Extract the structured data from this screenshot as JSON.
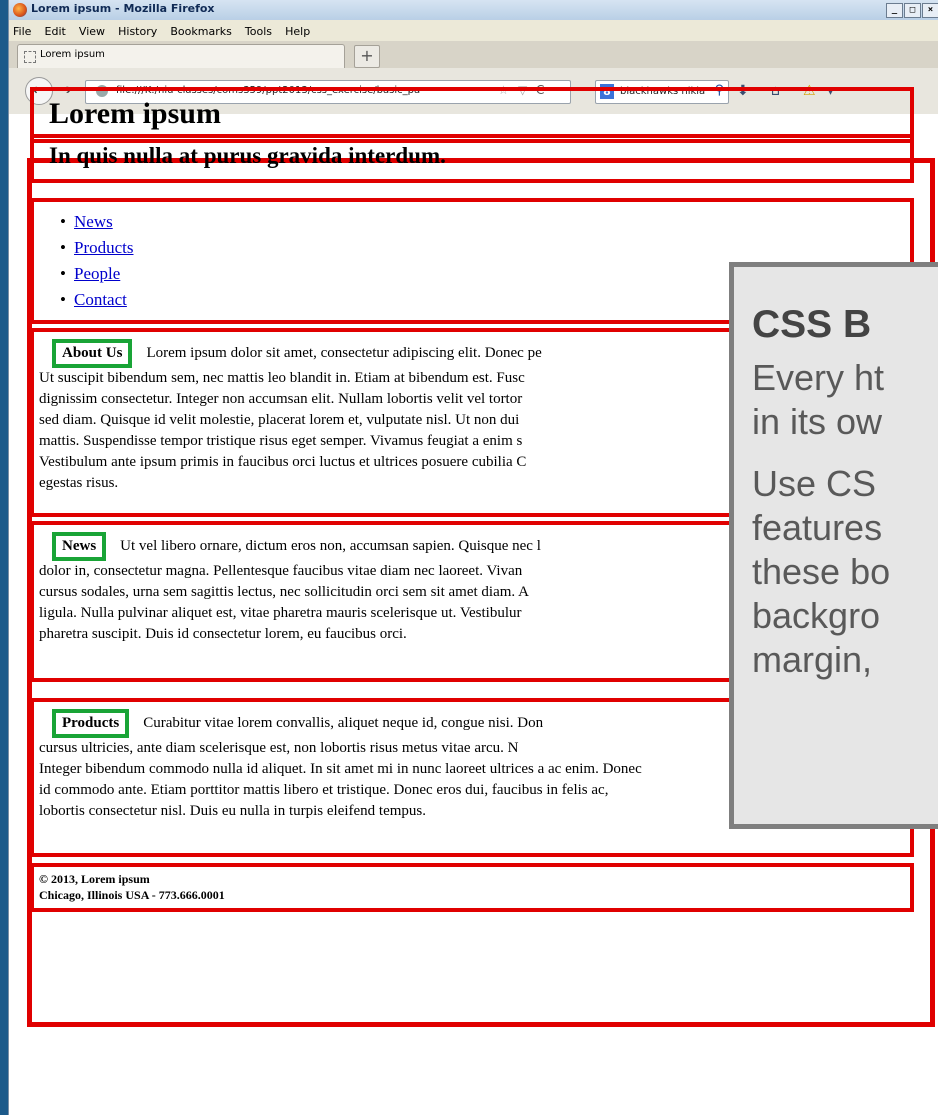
{
  "window": {
    "title": "Lorem ipsum - Mozilla Firefox",
    "buttons": [
      "_",
      "□",
      "×"
    ]
  },
  "menu": [
    "File",
    "Edit",
    "View",
    "History",
    "Bookmarks",
    "Tools",
    "Help"
  ],
  "tab": {
    "label": "Lorem ipsum",
    "new_tab": "+"
  },
  "navbar": {
    "url": "file:///K:/niu-classes/coms359/ppt2013/css_exercise/basic_pa",
    "search_engine": "8",
    "search_text": "blackhawks nikla"
  },
  "page": {
    "h1": "Lorem ipsum",
    "h2": "In quis nulla at purus gravida interdum.",
    "nav_links": [
      "News",
      "Products",
      "People",
      "Contact"
    ],
    "about": {
      "label": "About Us",
      "lines": [
        "Lorem ipsum dolor sit amet, consectetur adipiscing elit. Donec pe",
        "Ut suscipit bibendum sem, nec mattis leo blandit in. Etiam at bibendum est. Fusc",
        "dignissim consectetur. Integer non accumsan elit. Nullam lobortis velit vel tortor",
        "sed diam. Quisque id velit molestie, placerat lorem et, vulputate nisl. Ut non dui",
        "mattis. Suspendisse tempor tristique risus eget semper. Vivamus feugiat a enim s",
        "Vestibulum ante ipsum primis in faucibus orci luctus et ultrices posuere cubilia C",
        "egestas risus."
      ]
    },
    "news": {
      "label": "News",
      "lines": [
        "Ut vel libero ornare, dictum eros non, accumsan sapien. Quisque nec l",
        "dolor in, consectetur magna. Pellentesque faucibus vitae diam nec laoreet. Vivan",
        "cursus sodales, urna sem sagittis lectus, nec sollicitudin orci sem sit amet diam. A",
        "ligula. Nulla pulvinar aliquet est, vitae pharetra mauris scelerisque ut. Vestibulur",
        "pharetra suscipit. Duis id consectetur lorem, eu faucibus orci."
      ]
    },
    "products": {
      "label": "Products",
      "lines": [
        "Curabitur vitae lorem convallis, aliquet neque id, congue nisi. Don",
        "cursus ultricies, ante diam scelerisque est, non lobortis risus metus vitae arcu. N",
        "Integer bibendum commodo nulla id aliquet. In sit amet mi in nunc laoreet ultrices a ac enim. Donec",
        "id commodo ante. Etiam porttitor mattis libero et tristique. Donec eros dui, faucibus in felis ac,",
        "lobortis consectetur nisl. Duis eu nulla in turpis eleifend tempus."
      ]
    },
    "footer": {
      "line1": "© 2013, Lorem ipsum",
      "line2": "Chicago, Illinois USA - 773.666.0001"
    }
  },
  "overlay": {
    "title": "CSS B",
    "lines": [
      "Every ht",
      "in its ow",
      "Use CS",
      "features",
      "these bo",
      "backgro",
      "margin,"
    ]
  },
  "colors": {
    "section_border": "#e00000",
    "label_border": "#19a436",
    "link": "#0000cc"
  }
}
